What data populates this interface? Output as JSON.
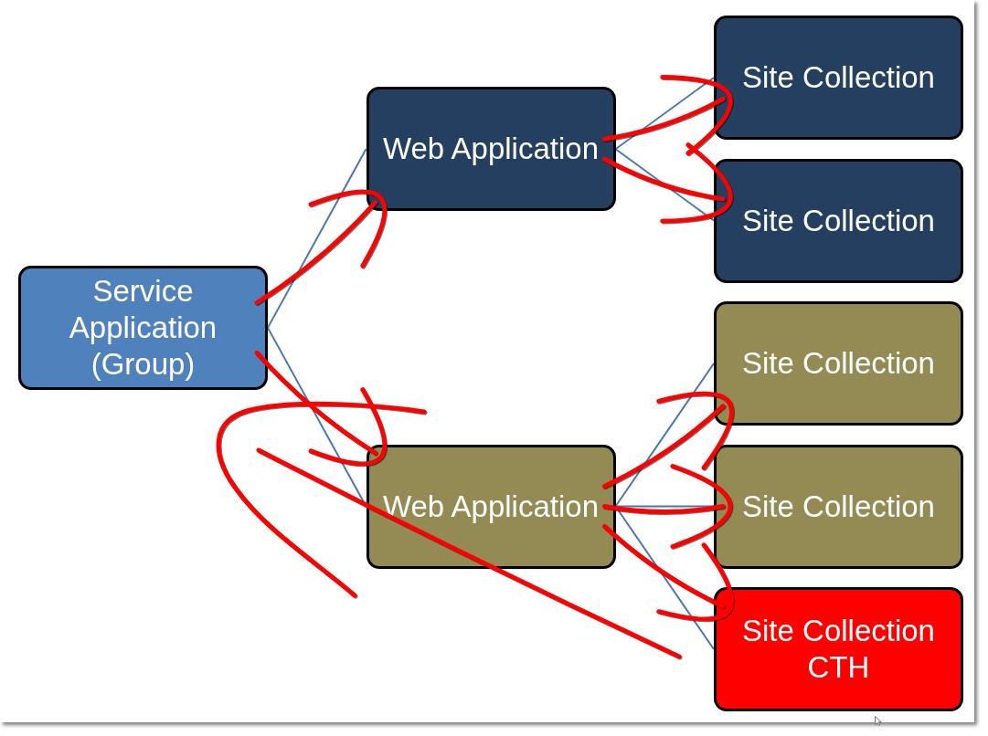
{
  "diagram": {
    "root": {
      "label": "Service Application (Group)",
      "color": "#4f81bd",
      "children": [
        {
          "label": "Web Application",
          "color": "#243f60",
          "ink_arrow": true,
          "children": [
            {
              "label": "Site Collection",
              "color": "#243f60",
              "ink_arrow": true
            },
            {
              "label": "Site Collection",
              "color": "#243f60",
              "ink_arrow": true
            }
          ]
        },
        {
          "label": "Web Application",
          "color": "#948a54",
          "ink_arrow": true,
          "children": [
            {
              "label": "Site Collection",
              "color": "#948a54",
              "ink_arrow": true
            },
            {
              "label": "Site Collection",
              "color": "#948a54",
              "ink_arrow": true
            },
            {
              "label": "Site Collection CTH",
              "color": "#ff0000",
              "ink_arrow": true
            }
          ]
        }
      ]
    }
  },
  "ink_scribbles": [
    {
      "kind": "loop"
    },
    {
      "kind": "line"
    }
  ]
}
